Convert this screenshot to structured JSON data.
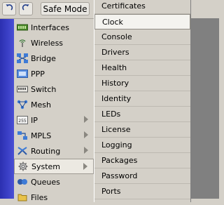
{
  "toolbar": {
    "undo_icon": "undo-arrow-icon",
    "redo_icon": "redo-arrow-icon",
    "safe_mode_label": "Safe Mode"
  },
  "menu": {
    "items": [
      {
        "label": "Interfaces",
        "icon": "interfaces-icon",
        "has_submenu": false
      },
      {
        "label": "Wireless",
        "icon": "wireless-icon",
        "has_submenu": false
      },
      {
        "label": "Bridge",
        "icon": "bridge-icon",
        "has_submenu": false
      },
      {
        "label": "PPP",
        "icon": "ppp-icon",
        "has_submenu": false
      },
      {
        "label": "Switch",
        "icon": "switch-icon",
        "has_submenu": false
      },
      {
        "label": "Mesh",
        "icon": "mesh-icon",
        "has_submenu": false
      },
      {
        "label": "IP",
        "icon": "ip-icon",
        "has_submenu": true
      },
      {
        "label": "MPLS",
        "icon": "mpls-icon",
        "has_submenu": true
      },
      {
        "label": "Routing",
        "icon": "routing-icon",
        "has_submenu": true
      },
      {
        "label": "System",
        "icon": "system-gear-icon",
        "has_submenu": true,
        "selected": true
      },
      {
        "label": "Queues",
        "icon": "queues-icon",
        "has_submenu": false
      },
      {
        "label": "Files",
        "icon": "files-icon",
        "has_submenu": false
      }
    ]
  },
  "submenu": {
    "items": [
      {
        "label": "Certificates"
      },
      {
        "label": "Clock",
        "highlighted": true
      },
      {
        "label": "Console"
      },
      {
        "label": "Drivers"
      },
      {
        "label": "Health"
      },
      {
        "label": "History"
      },
      {
        "label": "Identity"
      },
      {
        "label": "LEDs"
      },
      {
        "label": "License"
      },
      {
        "label": "Logging"
      },
      {
        "label": "Packages"
      },
      {
        "label": "Password"
      },
      {
        "label": "Ports"
      }
    ]
  },
  "colors": {
    "strip": "#3c41c8",
    "window_bg": "#d4d0c8",
    "desktop_gray": "#808080"
  }
}
